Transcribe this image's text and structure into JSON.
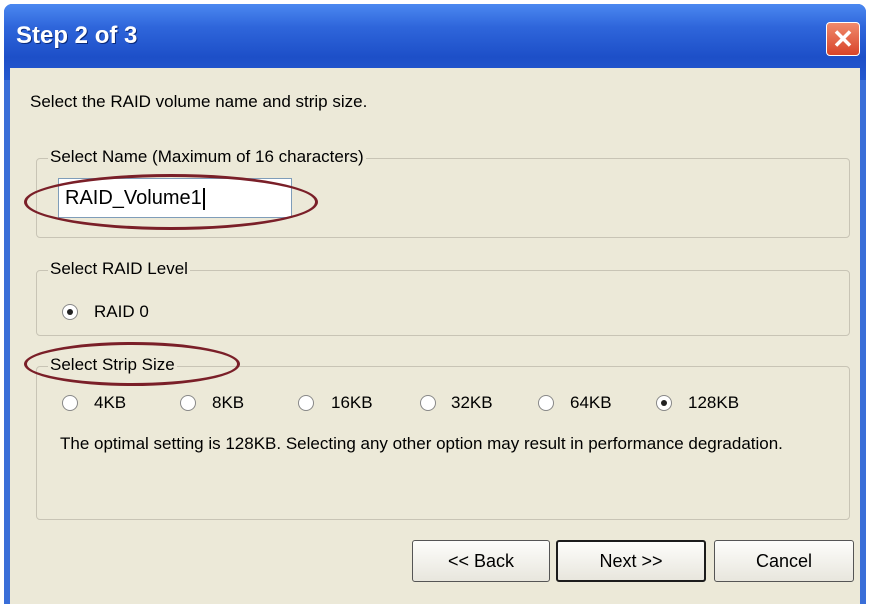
{
  "window": {
    "title": "Step 2 of 3",
    "close_glyph": "✕"
  },
  "intro": "Select the RAID volume name and strip size.",
  "name_group": {
    "label": "Select Name (Maximum of 16 characters)",
    "value": "RAID_Volume1"
  },
  "level_group": {
    "label": "Select RAID Level",
    "options": [
      {
        "label": "RAID 0",
        "selected": true
      }
    ]
  },
  "strip_group": {
    "label": "Select Strip Size",
    "options": [
      {
        "label": "4KB",
        "selected": false
      },
      {
        "label": "8KB",
        "selected": false
      },
      {
        "label": "16KB",
        "selected": false
      },
      {
        "label": "32KB",
        "selected": false
      },
      {
        "label": "64KB",
        "selected": false
      },
      {
        "label": "128KB",
        "selected": true
      }
    ],
    "note": "The optimal setting is 128KB. Selecting any other option may result in performance degradation."
  },
  "buttons": {
    "back": "<< Back",
    "next": "Next >>",
    "cancel": "Cancel"
  },
  "colors": {
    "title_bar": "#2458cf",
    "dialog_bg": "#ece9d8",
    "highlight_ellipse": "#7a1f28"
  }
}
